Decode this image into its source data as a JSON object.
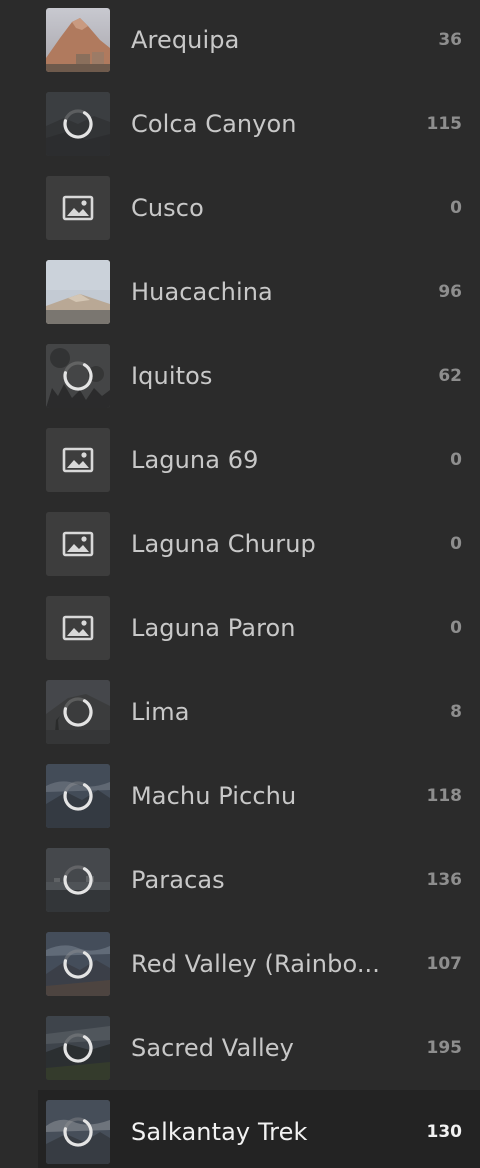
{
  "albums": [
    {
      "name": "Arequipa",
      "count": "36",
      "thumb": "arequipa",
      "loading": false
    },
    {
      "name": "Colca Canyon",
      "count": "115",
      "thumb": "canyon",
      "loading": true
    },
    {
      "name": "Cusco",
      "count": "0",
      "thumb": "placeholder",
      "loading": false
    },
    {
      "name": "Huacachina",
      "count": "96",
      "thumb": "dunes",
      "loading": false
    },
    {
      "name": "Iquitos",
      "count": "62",
      "thumb": "jungle",
      "loading": true
    },
    {
      "name": "Laguna 69",
      "count": "0",
      "thumb": "placeholder",
      "loading": false
    },
    {
      "name": "Laguna Churup",
      "count": "0",
      "thumb": "placeholder",
      "loading": false
    },
    {
      "name": "Laguna Paron",
      "count": "0",
      "thumb": "placeholder",
      "loading": false
    },
    {
      "name": "Lima",
      "count": "8",
      "thumb": "lima",
      "loading": true
    },
    {
      "name": "Machu Picchu",
      "count": "118",
      "thumb": "machu",
      "loading": true
    },
    {
      "name": "Paracas",
      "count": "136",
      "thumb": "paracas",
      "loading": true
    },
    {
      "name": "Red Valley (Rainbo...",
      "count": "107",
      "thumb": "redvalley",
      "loading": true
    },
    {
      "name": "Sacred Valley",
      "count": "195",
      "thumb": "sacred",
      "loading": true
    },
    {
      "name": "Salkantay Trek",
      "count": "130",
      "thumb": "salkantay",
      "loading": true
    }
  ],
  "selected_index": 13,
  "colors": {
    "background": "#2b2b2b",
    "selected_row": "#232323",
    "text": "#c8c8c8",
    "count_text": "#8e8e8e",
    "placeholder_tile": "#3d3d3d"
  },
  "icons": {
    "placeholder": "image-icon",
    "loading": "loading-spinner-icon"
  }
}
